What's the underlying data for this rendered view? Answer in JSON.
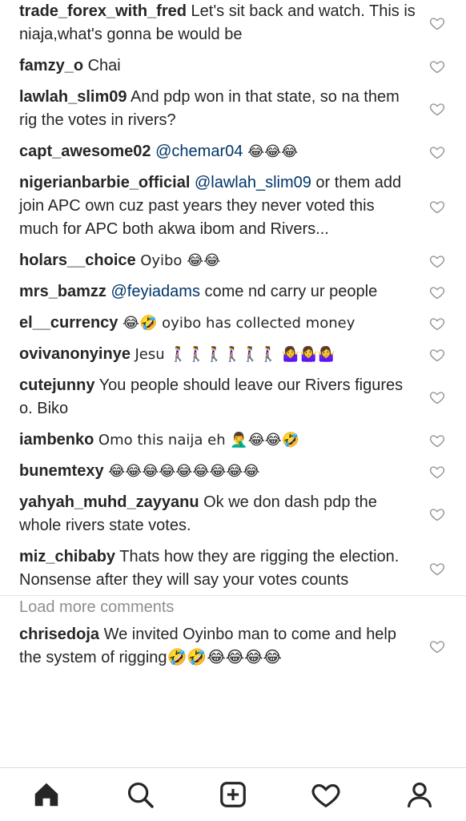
{
  "comments": [
    {
      "user": "trade_forex_with_fred",
      "text": "Let's sit back and watch. This is niaja,what's gonna be would be",
      "mention": "",
      "after": ""
    },
    {
      "user": "famzy_o",
      "text": "Chai",
      "mention": "",
      "after": ""
    },
    {
      "user": "lawlah_slim09",
      "text": "And pdp won in that state, so na them rig the votes in rivers?",
      "mention": "",
      "after": ""
    },
    {
      "user": "capt_awesome02",
      "text": "",
      "mention": "@chemar04",
      "after": " 😂😂😂"
    },
    {
      "user": "nigerianbarbie_official",
      "text": "",
      "mention": "@lawlah_slim09",
      "after": " or them add join APC own cuz past years they never voted this much for APC both akwa ibom and Rivers..."
    },
    {
      "user": "holars__choice",
      "text": "Oyibo 😂😂",
      "mention": "",
      "after": ""
    },
    {
      "user": "mrs_bamzz",
      "text": "",
      "mention": "@feyiadams",
      "after": " come nd carry ur people"
    },
    {
      "user": "el__currency",
      "text": "😂🤣 oyibo has collected money",
      "mention": "",
      "after": ""
    },
    {
      "user": "ovivanonyinye",
      "text": "Jesu 🚶‍♀️🚶‍♀️🚶‍♀️🚶‍♀️🚶‍♀️🚶‍♀️ 🤷‍♀️🤷‍♀️🤷‍♀️",
      "mention": "",
      "after": ""
    },
    {
      "user": "cutejunny",
      "text": "You people should leave our Rivers figures o. Biko",
      "mention": "",
      "after": ""
    },
    {
      "user": "iambenko",
      "text": "Omo this naija eh 🤦‍♂️😂😂🤣",
      "mention": "",
      "after": ""
    },
    {
      "user": "bunemtexy",
      "text": "😂😂😂😂😂😂😂😂😂",
      "mention": "",
      "after": ""
    },
    {
      "user": "yahyah_muhd_zayyanu",
      "text": "Ok we don dash pdp the whole rivers state votes.",
      "mention": "",
      "after": ""
    },
    {
      "user": "miz_chibaby",
      "text": "Thats how they are rigging the election. Nonsense after they will say your votes counts",
      "mention": "",
      "after": ""
    }
  ],
  "load_more": "Load more comments",
  "last_comment": {
    "user": "chrisedoja",
    "text": "We invited Oyinbo man to come and help the system of rigging🤣🤣😂😂😂😂"
  },
  "nav": [
    "home-icon",
    "search-icon",
    "add-post-icon",
    "activity-heart-icon",
    "profile-icon"
  ]
}
